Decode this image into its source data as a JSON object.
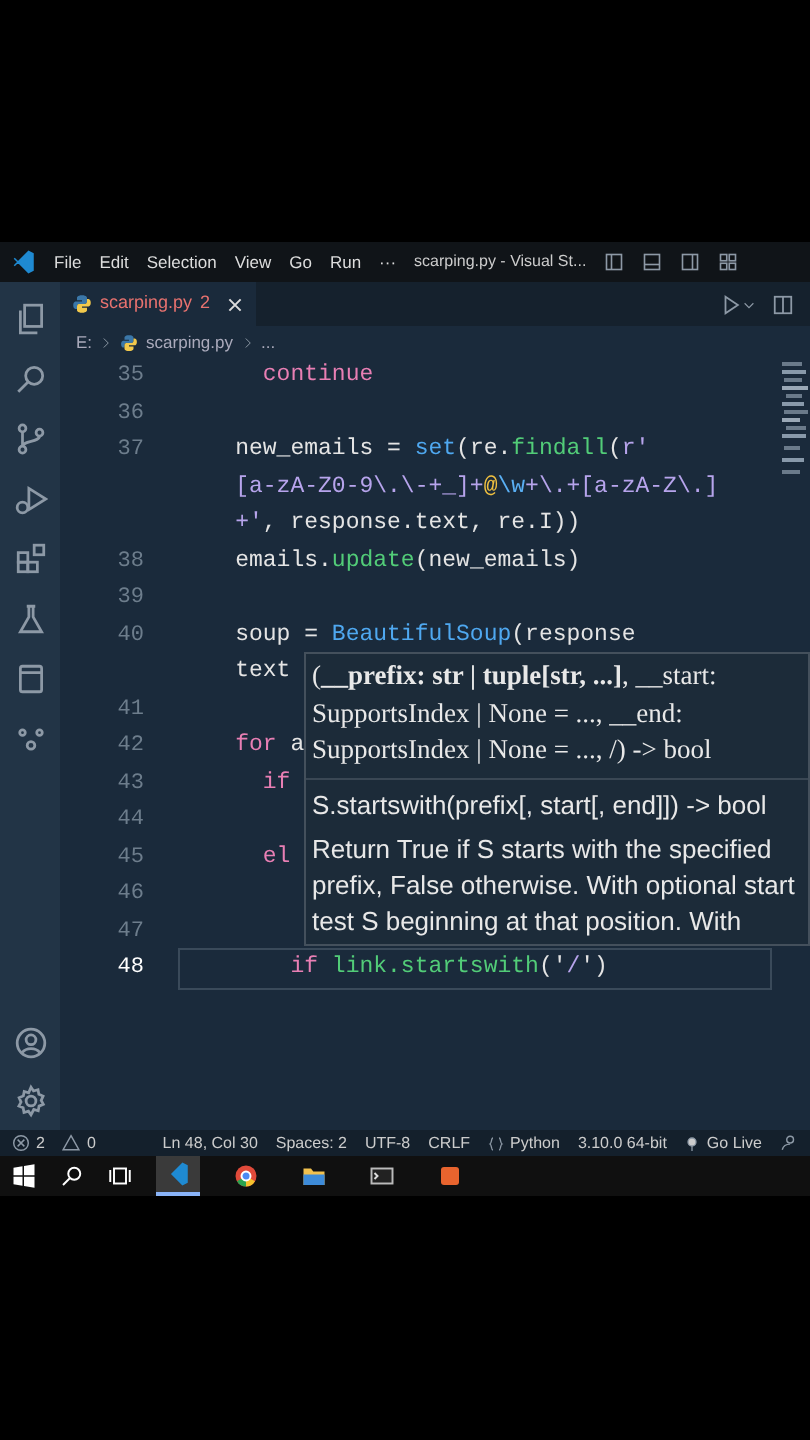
{
  "title_bar": {
    "menu": [
      "File",
      "Edit",
      "Selection",
      "View",
      "Go",
      "Run",
      "···"
    ],
    "title": "scarping.py - Visual St..."
  },
  "tabs": [
    {
      "label": "scarping.py",
      "problems": "2",
      "selected": true
    }
  ],
  "breadcrumbs": [
    "E:",
    "scarping.py",
    "..."
  ],
  "editor": {
    "lines": [
      {
        "number": "35",
        "current": false,
        "tokens": [
          {
            "kind": "kw",
            "text": "      continue"
          }
        ]
      },
      {
        "number": "36",
        "current": false
      },
      {
        "number": "37",
        "current": false,
        "tokens": [
          {
            "kind": "var",
            "text": "    new_emails = "
          },
          {
            "kind": "builtin",
            "text": "set"
          },
          {
            "kind": "var",
            "text": "(re."
          },
          {
            "kind": "fn",
            "text": "findall"
          },
          {
            "kind": "var",
            "text": "("
          },
          {
            "kind": "str",
            "text": "r'"
          }
        ]
      },
      {
        "current": false,
        "tokens": [
          {
            "kind": "str",
            "text": "    [a-zA-Z0-9\\.\\-+_]+"
          },
          {
            "kind": "special",
            "text": "@"
          },
          {
            "kind": "esc",
            "text": "\\w"
          },
          {
            "kind": "str",
            "text": "+\\.+[a-zA-Z\\.]"
          }
        ]
      },
      {
        "current": false,
        "tokens": [
          {
            "kind": "str",
            "text": "    +'"
          },
          {
            "kind": "var",
            "text": ", response.text, re.I))"
          }
        ]
      },
      {
        "number": "38",
        "current": false,
        "tokens": [
          {
            "kind": "var",
            "text": "    emails."
          },
          {
            "kind": "fn",
            "text": "update"
          },
          {
            "kind": "var",
            "text": "(new_emails)"
          }
        ]
      },
      {
        "number": "39",
        "current": false
      },
      {
        "number": "40",
        "current": false,
        "tokens": [
          {
            "kind": "var",
            "text": "    soup = "
          },
          {
            "kind": "cls",
            "text": "BeautifulSoup"
          },
          {
            "kind": "var",
            "text": "(response"
          }
        ]
      },
      {
        "current": false,
        "tokens": [
          {
            "kind": "var",
            "text": "    text"
          }
        ]
      },
      {
        "number": "41",
        "current": false
      },
      {
        "number": "42",
        "current": false,
        "tokens": [
          {
            "kind": "kw",
            "text": "    for"
          },
          {
            "kind": "var",
            "text": " a"
          }
        ]
      },
      {
        "number": "43",
        "current": false,
        "tokens": [
          {
            "kind": "kw",
            "text": "      if"
          }
        ]
      },
      {
        "number": "44",
        "current": false
      },
      {
        "number": "45",
        "current": false,
        "tokens": [
          {
            "kind": "kw",
            "text": "      el"
          }
        ]
      },
      {
        "number": "46",
        "current": false
      },
      {
        "number": "47",
        "current": false
      },
      {
        "number": "48",
        "current": true,
        "tokens": [
          {
            "kind": "kw",
            "text": "        if"
          },
          {
            "kind": "fn",
            "text": " link.startswith"
          },
          {
            "kind": "var",
            "text": "('"
          },
          {
            "kind": "str",
            "text": "/"
          },
          {
            "kind": "var",
            "text": "')"
          }
        ]
      }
    ]
  },
  "hover": {
    "signature": [
      "(**__prefix: str | tuple[str, ...]**, __start:",
      "SupportsIndex | None = ..., __end:",
      "SupportsIndex | None = ..., /) -> bool"
    ],
    "doc_title": "S.startswith(prefix[, start[, end]]) -> bool",
    "doc": [
      "Return True if S starts with the specified",
      "prefix, False otherwise. With optional start",
      "test S beginning at that position. With"
    ]
  },
  "status_bar": {
    "errors": "2",
    "warnings": "0",
    "items": [
      {
        "kind": "text",
        "text": "Ln 48, Col 30"
      },
      {
        "kind": "text",
        "text": "Spaces: 2"
      },
      {
        "kind": "text",
        "text": "UTF-8"
      },
      {
        "kind": "text",
        "text": "CRLF"
      },
      {
        "kind": "language",
        "text": "Python"
      },
      {
        "kind": "text",
        "text": "3.10.0 64-bit"
      },
      {
        "kind": "live",
        "text": "Go Live"
      }
    ]
  },
  "taskbar": {
    "apps": [
      {
        "selected": true
      },
      {
        "selected": false
      },
      {
        "selected": false
      },
      {
        "selected": false
      },
      {
        "selected": false
      }
    ]
  }
}
